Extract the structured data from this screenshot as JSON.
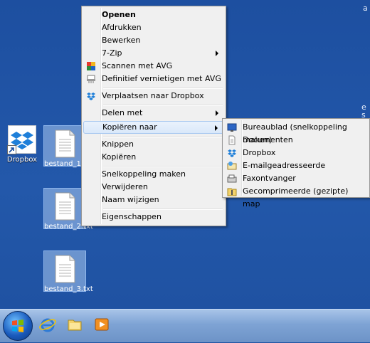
{
  "desktop": {
    "edge_text": [
      "e",
      "s a",
      "a"
    ],
    "icons": [
      {
        "label": "Dropbox"
      },
      {
        "label": "bestand_1.txt"
      },
      {
        "label": "bestand_2.txt"
      },
      {
        "label": "bestand_3.txt"
      }
    ]
  },
  "context_menu": {
    "items": [
      {
        "label": "Openen"
      },
      {
        "label": "Afdrukken"
      },
      {
        "label": "Bewerken"
      },
      {
        "label": "7-Zip"
      },
      {
        "label": "Scannen met AVG"
      },
      {
        "label": "Definitief vernietigen met AVG"
      },
      {
        "label": "Verplaatsen naar Dropbox"
      },
      {
        "label": "Delen met"
      },
      {
        "label": "Kopiëren naar"
      },
      {
        "label": "Knippen"
      },
      {
        "label": "Kopiëren"
      },
      {
        "label": "Snelkoppeling maken"
      },
      {
        "label": "Verwijderen"
      },
      {
        "label": "Naam wijzigen"
      },
      {
        "label": "Eigenschappen"
      }
    ]
  },
  "submenu": {
    "items": [
      {
        "label": "Bureaublad (snelkoppeling maken)"
      },
      {
        "label": "Documenten"
      },
      {
        "label": "Dropbox"
      },
      {
        "label": "E-mailgeadresseerde"
      },
      {
        "label": "Faxontvanger"
      },
      {
        "label": "Gecomprimeerde (gezipte) map"
      }
    ]
  },
  "colors": {
    "desktop": "#1f53a3",
    "menu_bg": "#f0f0f0",
    "highlight": "#d9e8fa"
  }
}
